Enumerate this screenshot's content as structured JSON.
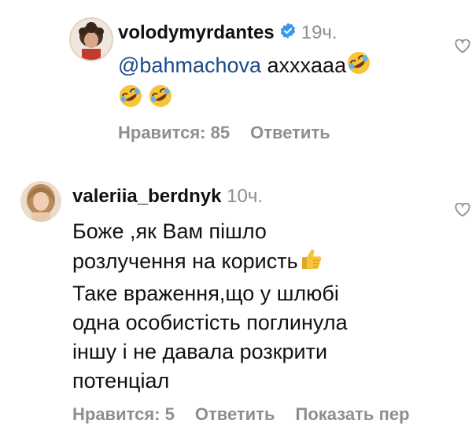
{
  "comments": [
    {
      "username": "volodymyrdantes",
      "verified": true,
      "time": "19ч.",
      "mention": "@bahmachova",
      "text": " axxxaaa",
      "likes_label": "Нравится: 85",
      "reply_label": "Ответить"
    },
    {
      "username": "valeriia_berdnyk",
      "verified": false,
      "time": "10ч.",
      "lines": [
        "Боже ,як Вам пішло",
        "розлучення на користь",
        "Таке враження,що у шлюбі",
        "одна особистість поглинула",
        "іншу і не давала розкрити",
        "потенціал"
      ],
      "likes_label": "Нравится: 5",
      "reply_label": "Ответить",
      "translate_label": "Показать пер"
    }
  ],
  "colors": {
    "text": "#111111",
    "muted": "#8e8e8e",
    "mention": "#1c4a86",
    "verified": "#3897f0"
  },
  "icons": [
    "heart-outline-icon",
    "verified-badge-icon",
    "rofl-emoji-icon",
    "thumbs-up-emoji-icon"
  ]
}
